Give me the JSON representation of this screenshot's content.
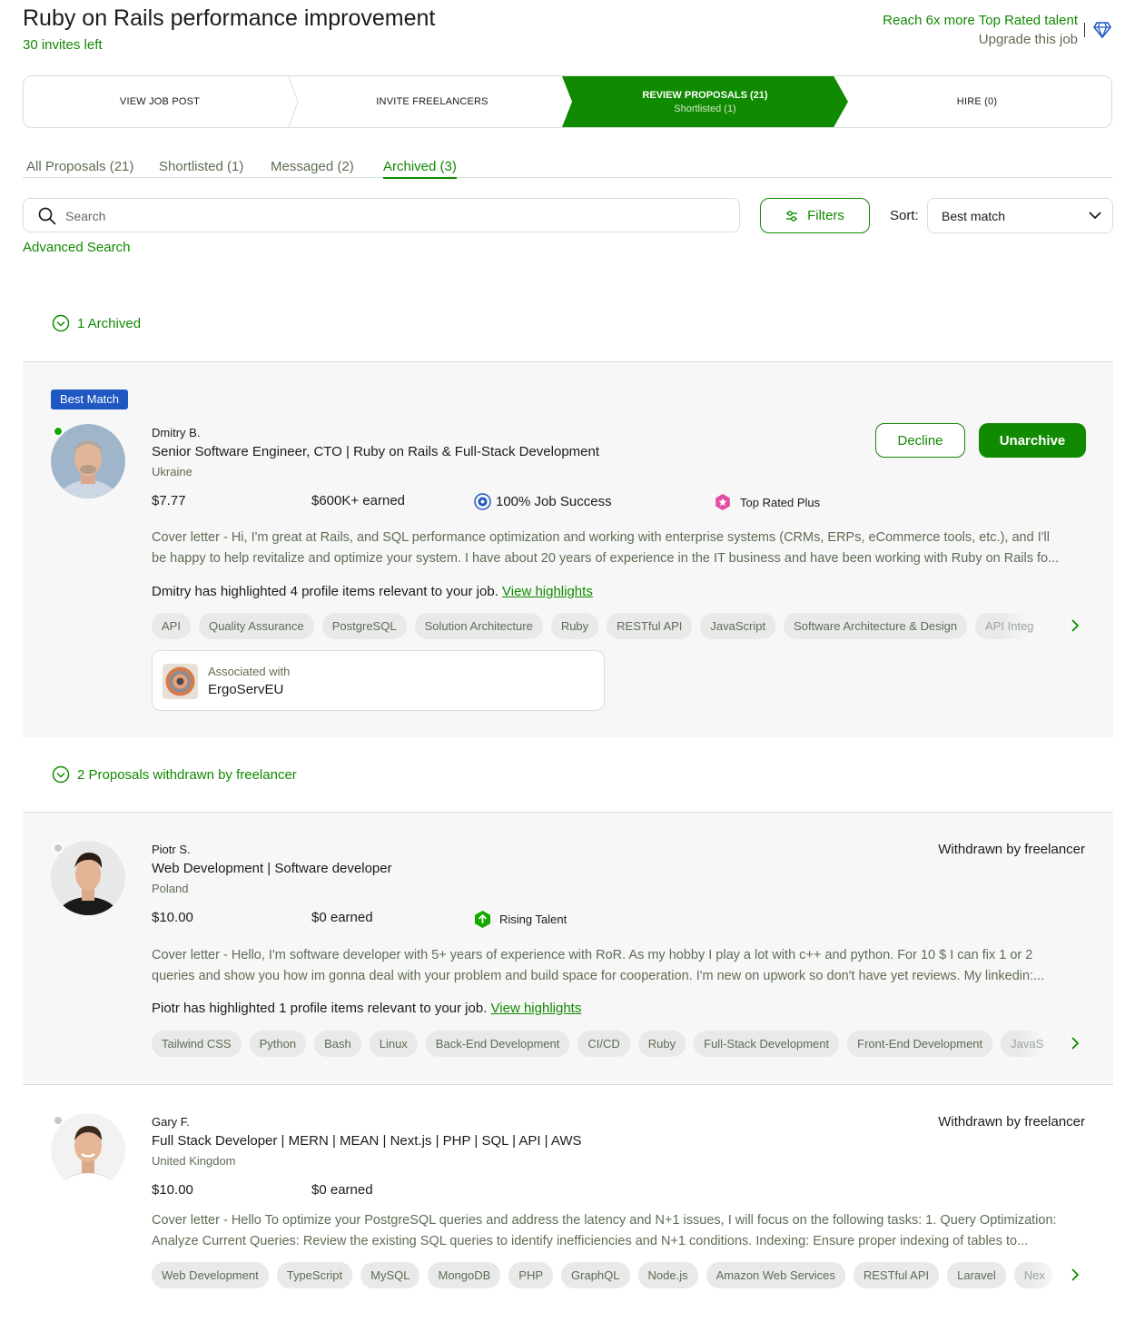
{
  "job": {
    "title": "Ruby on Rails performance improvement",
    "invites_left": "30 invites left",
    "reach_text": "Reach 6x more Top Rated talent",
    "upgrade_text": "Upgrade this job"
  },
  "stepper": {
    "step1": "VIEW JOB POST",
    "step2": "INVITE FREELANCERS",
    "step3": "REVIEW PROPOSALS (21)",
    "step3_sub": "Shortlisted (1)",
    "step4": "HIRE (0)"
  },
  "tabs": [
    "All Proposals (21)",
    "Shortlisted (1)",
    "Messaged (2)",
    "Archived (3)"
  ],
  "search": {
    "placeholder": "Search"
  },
  "filters_label": "Filters",
  "sort": {
    "label": "Sort:",
    "value": "Best match"
  },
  "advanced_search": "Advanced Search",
  "groups": {
    "archived": "1 Archived",
    "withdrawn": "2 Proposals withdrawn by freelancer"
  },
  "colors": {
    "accent": "#108a00",
    "badge": "#1f57c3",
    "card_bg": "#f7f7f7"
  },
  "proposals": [
    {
      "badge": "Best Match",
      "name": "Dmitry B.",
      "headline": "Senior Software Engineer, CTO | Ruby on Rails & Full-Stack Development",
      "country": "Ukraine",
      "rate": "$7.77",
      "earned": "$600K+ earned",
      "job_success": "100% Job Success",
      "talent_badge": "Top Rated Plus",
      "cover_line1": "Cover letter - Hi, I'm great at Rails, and SQL performance optimization and working with enterprise systems (CRMs, ERPs, eCommerce tools, etc.), and I'll",
      "cover_line2": "be happy to help revitalize and optimize your system. I have about 20 years of experience in the IT business and have been working with Ruby on Rails fo...",
      "highlight_text": "Dmitry has highlighted 4 profile items relevant to your job.",
      "highlight_link": "View highlights",
      "skills": [
        "API",
        "Quality Assurance",
        "PostgreSQL",
        "Solution Architecture",
        "Ruby",
        "RESTful API",
        "JavaScript",
        "Software Architecture & Design"
      ],
      "skill_cut": "API Integ",
      "assoc_label": "Associated with",
      "assoc_name": "ErgoServEU",
      "decline": "Decline",
      "unarchive": "Unarchive"
    },
    {
      "name": "Piotr S.",
      "headline": "Web Development | Software developer",
      "country": "Poland",
      "rate": "$10.00",
      "earned": "$0 earned",
      "talent_badge": "Rising Talent",
      "status": "Withdrawn by freelancer",
      "cover_line1": "Cover letter - Hello, I'm software developer with 5+ years of experience with RoR. As my hobby I play a lot with c++ and python. For 10 $ I can fix 1 or 2",
      "cover_line2": "queries and show you how im gonna deal with your problem and build space for cooperation. I'm new on upwork so don't have yet reviews. My linkedin:...",
      "highlight_text": "Piotr has highlighted 1 profile items relevant to your job.",
      "highlight_link": "View highlights",
      "skills": [
        "Tailwind CSS",
        "Python",
        "Bash",
        "Linux",
        "Back-End Development",
        "CI/CD",
        "Ruby",
        "Full-Stack Development",
        "Front-End Development"
      ],
      "skill_cut": "JavaS"
    },
    {
      "name": "Gary F.",
      "headline": "Full Stack Developer | MERN | MEAN | Next.js | PHP | SQL | API | AWS",
      "country": "United Kingdom",
      "rate": "$10.00",
      "earned": "$0 earned",
      "status": "Withdrawn by freelancer",
      "cover_line1": "Cover letter - Hello To optimize your PostgreSQL queries and address the latency and N+1 issues, I will focus on the following tasks: 1. Query Optimization:",
      "cover_line2": "Analyze Current Queries: Review the existing SQL queries to identify inefficiencies and N+1 conditions. Indexing: Ensure proper indexing of tables to...",
      "skills": [
        "Web Development",
        "TypeScript",
        "MySQL",
        "MongoDB",
        "PHP",
        "GraphQL",
        "Node.js",
        "Amazon Web Services",
        "RESTful API",
        "Laravel"
      ],
      "skill_cut": "Nex"
    }
  ]
}
